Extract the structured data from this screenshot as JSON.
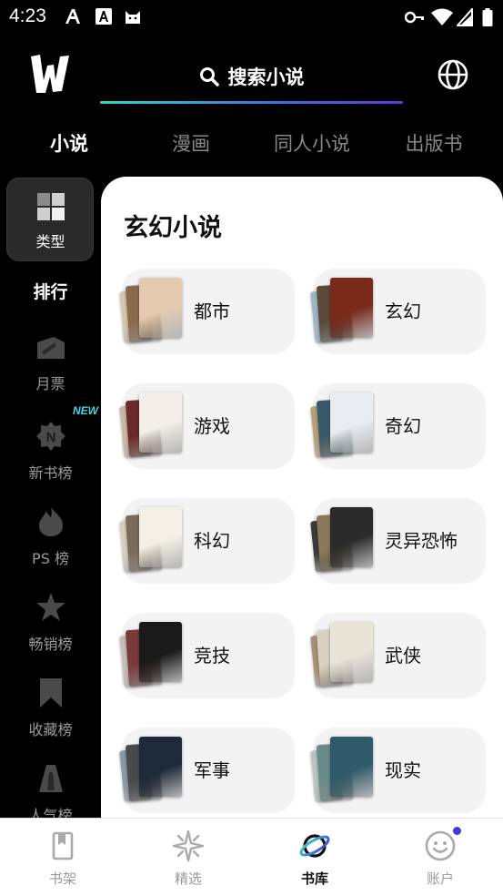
{
  "status_bar": {
    "time": "4:23",
    "notification_icons": [
      "font-a-icon",
      "font-a-box-icon",
      "cat-icon"
    ],
    "right_icons": [
      "key-icon",
      "wifi-icon",
      "signal-icon",
      "battery-icon"
    ]
  },
  "header": {
    "logo": "W",
    "search_label": "搜索小说",
    "globe_icon": "globe-icon"
  },
  "tabs": [
    {
      "label": "小说",
      "active": true
    },
    {
      "label": "漫画",
      "active": false
    },
    {
      "label": "同人小说",
      "active": false
    },
    {
      "label": "出版书",
      "active": false
    }
  ],
  "sidebar": {
    "items": [
      {
        "label": "类型",
        "icon": "category-icon",
        "active": true
      },
      {
        "label": "排行",
        "icon": "",
        "active": false
      },
      {
        "label": "月票",
        "icon": "ticket-icon",
        "active": false
      },
      {
        "label": "新书榜",
        "icon": "new-book-icon",
        "active": false,
        "badge": "NEW"
      },
      {
        "label": "PS 榜",
        "icon": "flame-icon",
        "active": false
      },
      {
        "label": "畅销榜",
        "icon": "star-icon",
        "active": false
      },
      {
        "label": "收藏榜",
        "icon": "bookmark-icon",
        "active": false
      },
      {
        "label": "人气榜",
        "icon": "popularity-icon",
        "active": false
      }
    ]
  },
  "content": {
    "title": "玄幻小说",
    "categories": [
      {
        "name": "都市",
        "colors": [
          "#d8c7b0",
          "#8b6a4c",
          "#e4cbb0"
        ]
      },
      {
        "name": "玄幻",
        "colors": [
          "#9eb7c7",
          "#5b4a3a",
          "#7a2a1a"
        ]
      },
      {
        "name": "游戏",
        "colors": [
          "#c9b8a8",
          "#6a2a2a",
          "#f2efe8"
        ]
      },
      {
        "name": "奇幻",
        "colors": [
          "#b8a07a",
          "#3a5a6a",
          "#e8ecef"
        ]
      },
      {
        "name": "科幻",
        "colors": [
          "#d6d0c0",
          "#7a6a5a",
          "#f3f1e6"
        ]
      },
      {
        "name": "灵异恐怖",
        "colors": [
          "#3a3a3a",
          "#8a7a5a",
          "#2a2a2a"
        ]
      },
      {
        "name": "竞技",
        "colors": [
          "#c8c0b8",
          "#7a3a3a",
          "#1a1a1a"
        ]
      },
      {
        "name": "武侠",
        "colors": [
          "#a89078",
          "#d8d0c0",
          "#e8e4d8"
        ]
      },
      {
        "name": "军事",
        "colors": [
          "#8a9aa8",
          "#4a4a4a",
          "#1e2a3a"
        ]
      },
      {
        "name": "现实",
        "colors": [
          "#b8c8c0",
          "#6a8a8a",
          "#2f5a6a"
        ]
      }
    ]
  },
  "bottom_nav": [
    {
      "label": "书架",
      "icon": "bookshelf-icon",
      "active": false
    },
    {
      "label": "精选",
      "icon": "sparkle-icon",
      "active": false
    },
    {
      "label": "书库",
      "icon": "planet-icon",
      "active": true
    },
    {
      "label": "账户",
      "icon": "smiley-icon",
      "active": false
    }
  ]
}
